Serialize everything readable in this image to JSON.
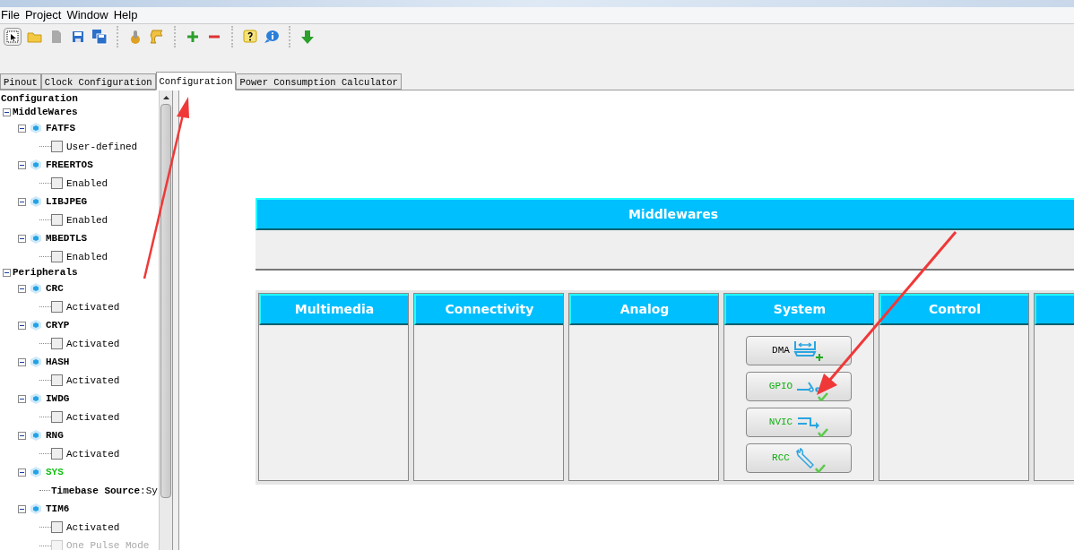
{
  "menu": [
    "File",
    "Project",
    "Window",
    "Help"
  ],
  "tabs": [
    {
      "label": "Pinout",
      "selected": false
    },
    {
      "label": "Clock Configuration",
      "selected": false
    },
    {
      "label": "Configuration",
      "selected": true
    },
    {
      "label": "Power Consumption Calculator",
      "selected": false
    }
  ],
  "tree": {
    "title": "Configuration",
    "groups": [
      {
        "label": "MiddleWares",
        "expanded": true,
        "children": [
          {
            "label": "FATFS",
            "configured": false,
            "expanded": true,
            "children": [
              {
                "kind": "checkbox",
                "label": "User-defined",
                "checked": false,
                "disabled": false
              }
            ]
          },
          {
            "label": "FREERTOS",
            "configured": false,
            "expanded": true,
            "children": [
              {
                "kind": "checkbox",
                "label": "Enabled",
                "checked": false,
                "disabled": false
              }
            ]
          },
          {
            "label": "LIBJPEG",
            "configured": false,
            "expanded": true,
            "children": [
              {
                "kind": "checkbox",
                "label": "Enabled",
                "checked": false,
                "disabled": false
              }
            ]
          },
          {
            "label": "MBEDTLS",
            "configured": false,
            "expanded": true,
            "children": [
              {
                "kind": "checkbox",
                "label": "Enabled",
                "checked": false,
                "disabled": false
              }
            ]
          }
        ]
      },
      {
        "label": "Peripherals",
        "expanded": true,
        "children": [
          {
            "label": "CRC",
            "configured": false,
            "expanded": true,
            "children": [
              {
                "kind": "checkbox",
                "label": "Activated",
                "checked": false,
                "disabled": false
              }
            ]
          },
          {
            "label": "CRYP",
            "configured": false,
            "expanded": true,
            "children": [
              {
                "kind": "checkbox",
                "label": "Activated",
                "checked": false,
                "disabled": false
              }
            ]
          },
          {
            "label": "HASH",
            "configured": false,
            "expanded": true,
            "children": [
              {
                "kind": "checkbox",
                "label": "Activated",
                "checked": false,
                "disabled": false
              }
            ]
          },
          {
            "label": "IWDG",
            "configured": false,
            "expanded": true,
            "children": [
              {
                "kind": "checkbox",
                "label": "Activated",
                "checked": false,
                "disabled": false
              }
            ]
          },
          {
            "label": "RNG",
            "configured": false,
            "expanded": true,
            "children": [
              {
                "kind": "checkbox",
                "label": "Activated",
                "checked": false,
                "disabled": false
              }
            ]
          },
          {
            "label": "SYS",
            "configured": true,
            "expanded": true,
            "children": [
              {
                "kind": "text",
                "label": "**Timebase Source**:Sy"
              }
            ]
          },
          {
            "label": "TIM6",
            "configured": false,
            "expanded": true,
            "children": [
              {
                "kind": "checkbox",
                "label": "Activated",
                "checked": false,
                "disabled": false
              },
              {
                "kind": "checkbox",
                "label": "One Pulse Mode",
                "checked": false,
                "disabled": true
              }
            ]
          }
        ]
      }
    ]
  },
  "middlewares": {
    "title": "Middlewares"
  },
  "categories": [
    {
      "title": "Multimedia"
    },
    {
      "title": "Connectivity"
    },
    {
      "title": "Analog"
    },
    {
      "title": "System",
      "buttons": [
        {
          "label": "DMA",
          "kind": "dma",
          "configured": false
        },
        {
          "label": "GPIO",
          "kind": "gpio",
          "configured": true
        },
        {
          "label": "NVIC",
          "kind": "nvic",
          "configured": true
        },
        {
          "label": "RCC",
          "kind": "rcc",
          "configured": true
        }
      ]
    },
    {
      "title": "Control"
    }
  ],
  "more_categories_clipped": true
}
